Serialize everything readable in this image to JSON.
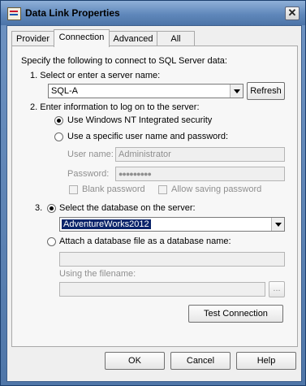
{
  "window": {
    "title": "Data Link Properties",
    "close_glyph": "✕"
  },
  "tabs": [
    {
      "label": "Provider"
    },
    {
      "label": "Connection"
    },
    {
      "label": "Advanced"
    },
    {
      "label": "All"
    }
  ],
  "connection": {
    "intro": "Specify the following to connect to SQL Server data:",
    "step1_label": "1. Select or enter a server name:",
    "server_name": "SQL-A",
    "refresh_label": "Refresh",
    "step2_label": "2. Enter information to log on to the server:",
    "nt_security_label": "Use Windows NT Integrated security",
    "nt_security_selected": true,
    "specific_user_label": "Use a specific user name and password:",
    "specific_user_selected": false,
    "username_label": "User name:",
    "username_value": "Administrator",
    "password_label": "Password:",
    "password_value": "●●●●●●●●●",
    "blank_password_label": "Blank password",
    "blank_password_checked": false,
    "allow_saving_label": "Allow saving password",
    "allow_saving_checked": false,
    "step3_number": "3.",
    "select_db_label": "Select the database on the server:",
    "select_db_selected": true,
    "database_value": "AdventureWorks2012",
    "attach_db_label": "Attach a database file as a database name:",
    "attach_db_selected": false,
    "attach_db_value": "",
    "filename_label": "Using the filename:",
    "filename_value": "",
    "browse_label": "...",
    "test_connection_label": "Test Connection"
  },
  "footer": {
    "ok_label": "OK",
    "cancel_label": "Cancel",
    "help_label": "Help"
  }
}
